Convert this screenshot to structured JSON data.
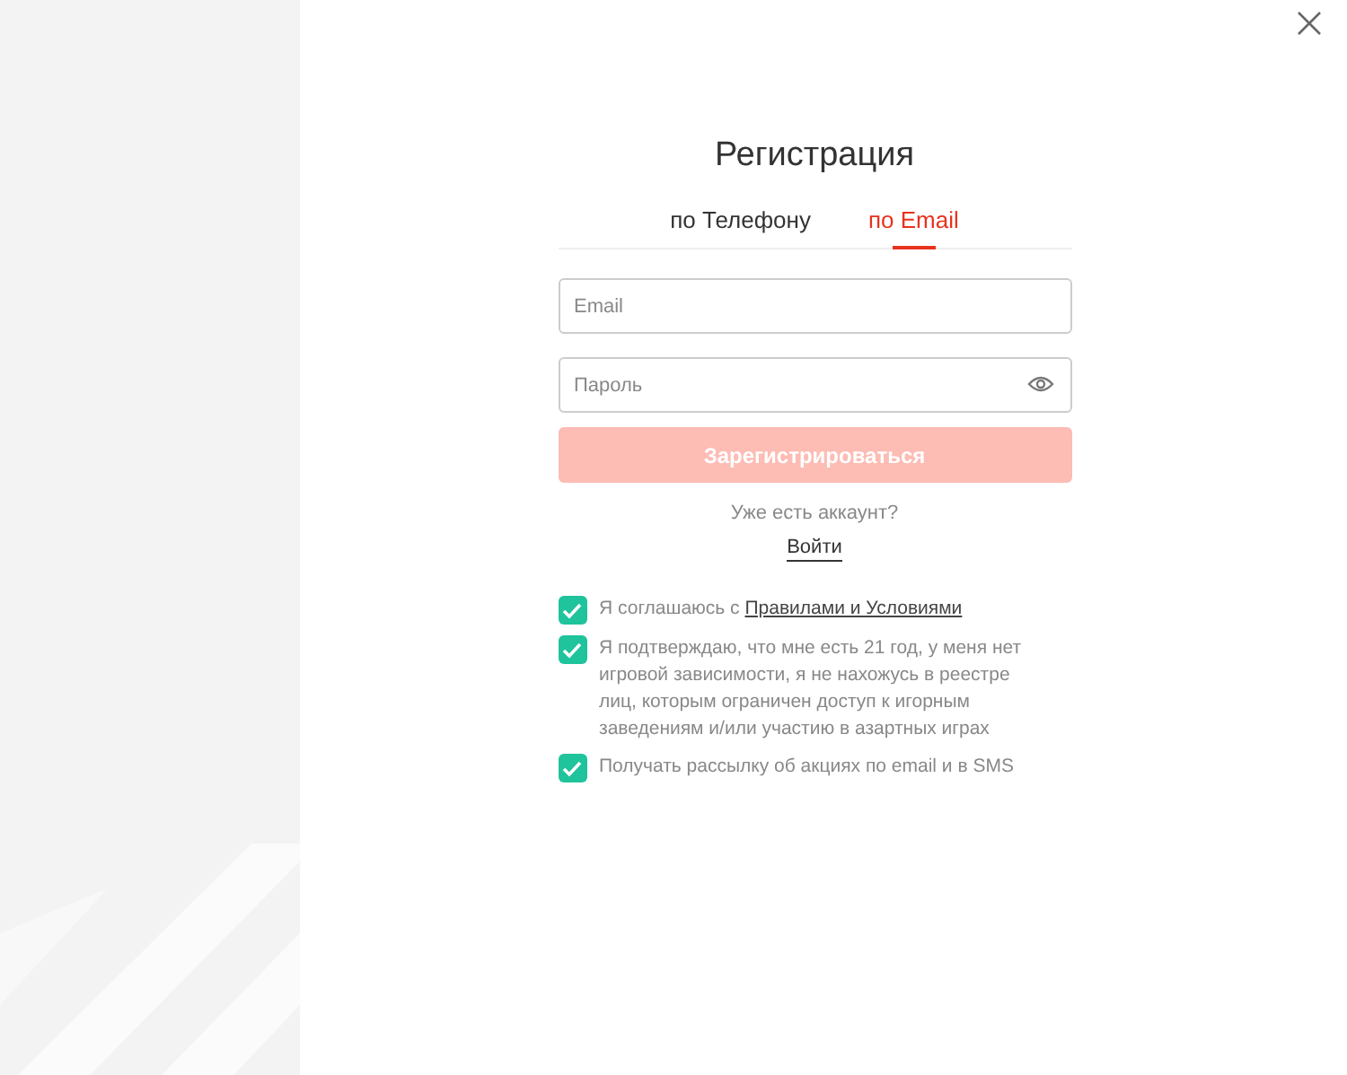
{
  "title": "Регистрация",
  "tabs": [
    {
      "label": "по Телефону",
      "selected": false
    },
    {
      "label": "по Email",
      "selected": true
    }
  ],
  "fields": [
    {
      "kind": "text",
      "placeholder": "Email"
    },
    {
      "kind": "password",
      "placeholder": "Пароль"
    }
  ],
  "submit": {
    "label": "Зарегистрироваться",
    "disabled": true
  },
  "login_prompt": "Уже есть аккаунт?",
  "login_link": "Войти",
  "agreements": [
    {
      "label": "Я соглашаюсь с",
      "link": "Правилами и Условиями",
      "checked": true
    },
    {
      "label": "Я подтверждаю, что мне есть 21 год, у меня нет игровой зависимости, я не нахожусь в реестре лиц, которым ограничен доступ к игорным заведениям и/или участию в азартных играх",
      "checked": true
    },
    {
      "label": "Получать рассылку об акциях по email и в SMS",
      "checked": true
    }
  ]
}
